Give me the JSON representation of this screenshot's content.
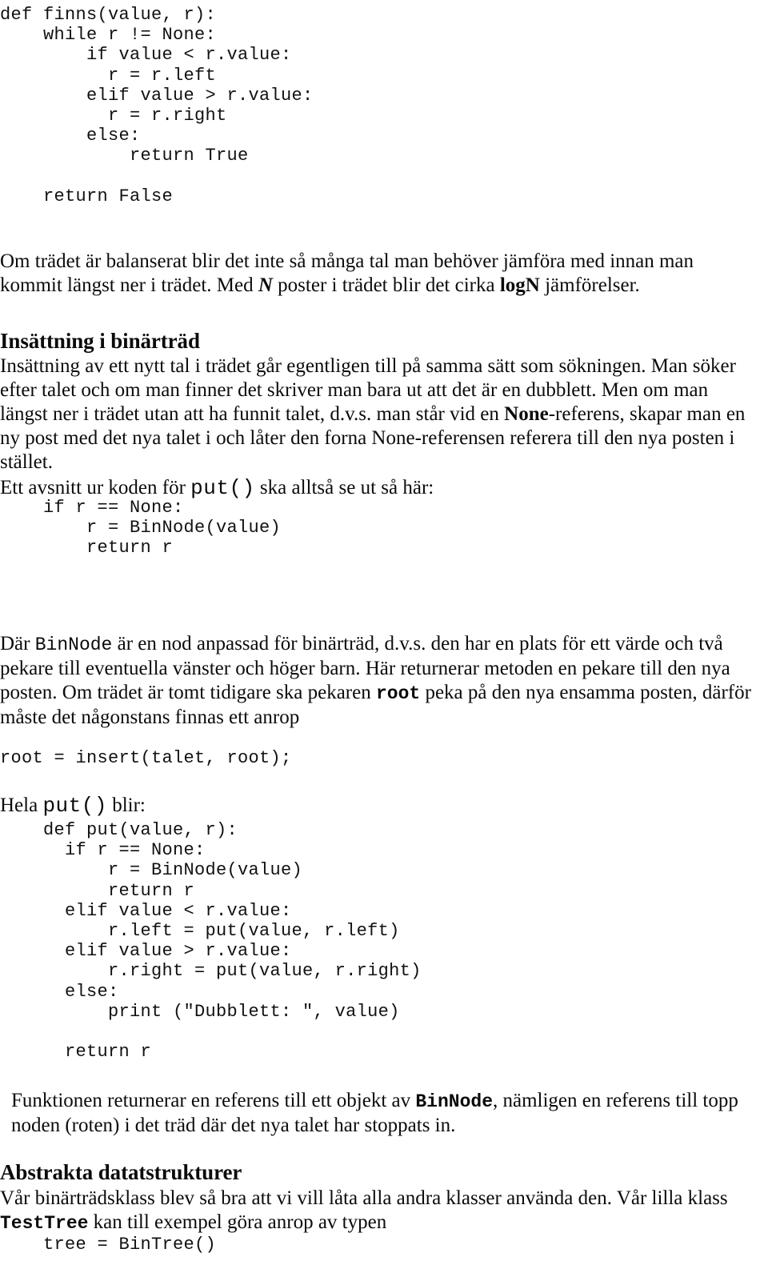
{
  "document": {
    "language": "sv",
    "colors": {
      "background": "#ffffff",
      "text": "#0b0b0b",
      "code_text": "#111111"
    }
  },
  "code_blocks": {
    "finns_function": "def finns(value, r):\n    while r != None:\n        if value < r.value:\n          r = r.left\n        elif value > r.value:\n          r = r.right\n        else:\n            return True\n\n    return False",
    "put_snippet": "    if r == None:\n        r = BinNode(value)\n        return r",
    "root_insert": "root = insert(talet, root);",
    "put_full": "    def put(value, r):\n      if r == None:\n          r = BinNode(value)\n          return r\n      elif value < r.value:\n          r.left = put(value, r.left)\n      elif value > r.value:\n          r.right = put(value, r.right)\n      else:\n          print (\"Dubblett: \", value)\n\n      return r",
    "bintree_call": "    tree = BinTree()"
  },
  "paragraphs": {
    "balanserat": {
      "part1": "Om trädet är balanserat blir det inte så många tal man behöver jämföra med innan man kommit längst ner i trädet. Med ",
      "emph_n": "N",
      "part2": " poster i trädet blir det cirka ",
      "emph_logn": "logN",
      "part3": " jämförelser."
    },
    "insattning": {
      "part1": "Insättning av ett nytt tal i trädet går egentligen till på samma sätt som sökningen. Man söker efter talet och om man finner det skriver man bara ut att det är en dubblett. Men om man längst ner i trädet utan att ha funnit talet, d.v.s. man står vid en ",
      "emph_none": "None",
      "part2": "-referens, skapar man en ny post med det nya talet i och låter den forna None-referensen referera till den nya posten i stället."
    },
    "avsnitt": {
      "part1": "Ett avsnitt ur koden för ",
      "code_put": "put()",
      "part2": " ska alltså se ut så här:"
    },
    "binnode": {
      "part1": "Där ",
      "code_binnode": "BinNode",
      "part2": " är en nod anpassad för binärträd, d.v.s. den har en plats för ett värde och två pekare till eventuella vänster och höger barn. Här returnerar metoden en pekare till den nya posten. Om trädet är tomt tidigare ska pekaren ",
      "code_root": "root",
      "part3": " peka på den nya ensamma posten, därför måste det någonstans finnas ett anrop"
    },
    "hela": {
      "part1": "Hela ",
      "code_put": "put()",
      "part2": " blir:"
    },
    "funktionen": {
      "part1": "Funktionen returnerar en referens till ett objekt av ",
      "code_binnode": "BinNode",
      "part2": ", nämligen en referens till topp noden (roten) i det träd där det nya talet har stoppats in."
    },
    "abstrakta": {
      "part1": "Vår binärträdsklass blev så bra att vi vill låta alla andra klasser använda den. Vår lilla klass ",
      "code_testtree": "TestTree",
      "part2": " kan till exempel göra anrop av typen"
    }
  },
  "headings": {
    "insattning_i_binartrad": "Insättning i binärträd",
    "abstrakta_datatstrukturer": "Abstrakta datatstrukturer"
  }
}
